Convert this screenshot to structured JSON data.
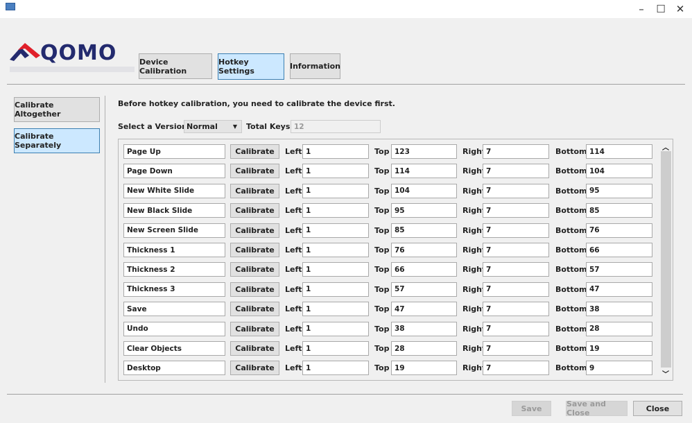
{
  "window": {
    "icon": "app-monitor-icon",
    "minimize": "–",
    "maximize": "☐",
    "close": "✕"
  },
  "logo": {
    "text": "QOMO",
    "colors": {
      "red": "#e0202a",
      "navy": "#232a6e"
    }
  },
  "tabs": [
    {
      "label": "Device Calibration",
      "selected": false
    },
    {
      "label": "Hotkey Settings",
      "selected": true
    },
    {
      "label": "Information",
      "selected": false
    }
  ],
  "sidebar": [
    {
      "label": "Calibrate Altogether",
      "selected": false
    },
    {
      "label": "Calibrate Separately",
      "selected": true
    }
  ],
  "main": {
    "notice": "Before hotkey calibration, you need to calibrate the device first.",
    "version_label": "Select a Version:",
    "version_value": "Normal",
    "total_keys_label": "Total Keys:",
    "total_keys_value": "12",
    "calibrate_label": "Calibrate",
    "left_label": "Left",
    "top_label": "Top",
    "right_label": "Right",
    "bottom_label": "Bottom",
    "rows": [
      {
        "name": "Page Up",
        "left": "1",
        "top": "123",
        "right": "7",
        "bottom": "114"
      },
      {
        "name": "Page Down",
        "left": "1",
        "top": "114",
        "right": "7",
        "bottom": "104"
      },
      {
        "name": "New White Slide",
        "left": "1",
        "top": "104",
        "right": "7",
        "bottom": "95"
      },
      {
        "name": "New Black Slide",
        "left": "1",
        "top": "95",
        "right": "7",
        "bottom": "85"
      },
      {
        "name": "New Screen Slide",
        "left": "1",
        "top": "85",
        "right": "7",
        "bottom": "76"
      },
      {
        "name": "Thickness 1",
        "left": "1",
        "top": "76",
        "right": "7",
        "bottom": "66"
      },
      {
        "name": "Thickness 2",
        "left": "1",
        "top": "66",
        "right": "7",
        "bottom": "57"
      },
      {
        "name": "Thickness 3",
        "left": "1",
        "top": "57",
        "right": "7",
        "bottom": "47"
      },
      {
        "name": "Save",
        "left": "1",
        "top": "47",
        "right": "7",
        "bottom": "38"
      },
      {
        "name": "Undo",
        "left": "1",
        "top": "38",
        "right": "7",
        "bottom": "28"
      },
      {
        "name": "Clear Objects",
        "left": "1",
        "top": "28",
        "right": "7",
        "bottom": "19"
      },
      {
        "name": "Desktop",
        "left": "1",
        "top": "19",
        "right": "7",
        "bottom": "9"
      }
    ]
  },
  "footer": {
    "save": "Save",
    "save_close": "Save and Close",
    "close": "Close"
  }
}
